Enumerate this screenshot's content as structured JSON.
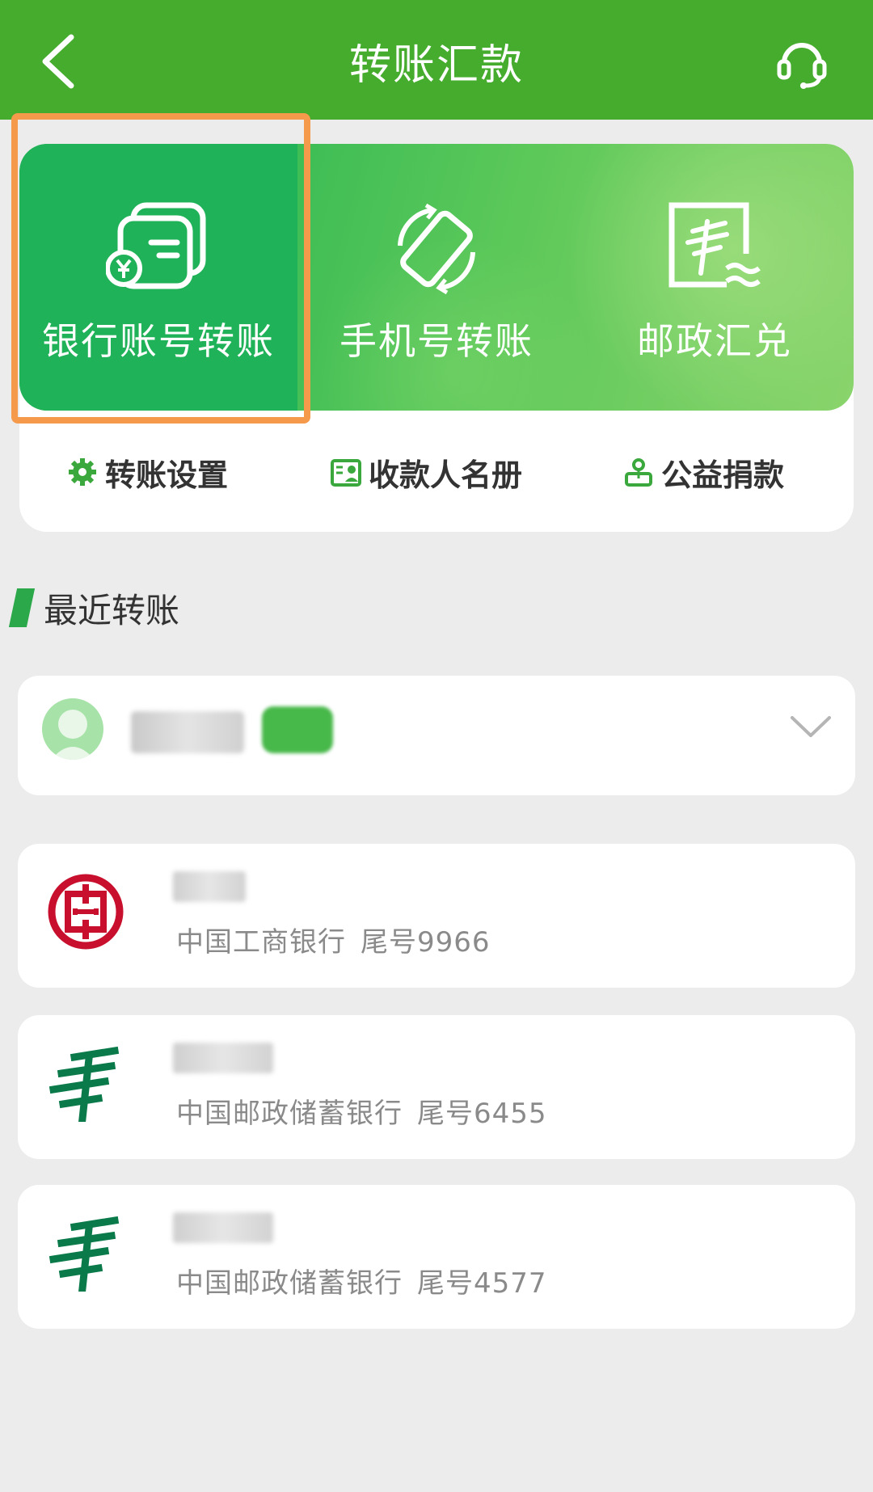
{
  "header": {
    "title": "转账汇款",
    "back_icon": "chevron-left-icon",
    "service_icon": "headset-icon"
  },
  "main_functions": [
    {
      "label": "银行账号转账",
      "icon": "bank-card-transfer-icon",
      "selected": true
    },
    {
      "label": "手机号转账",
      "icon": "phone-rotate-icon",
      "selected": false
    },
    {
      "label": "邮政汇兑",
      "icon": "postal-remittance-icon",
      "selected": false
    }
  ],
  "sub_functions": [
    {
      "label": "转账设置",
      "icon": "gear-icon"
    },
    {
      "label": "收款人名册",
      "icon": "contact-book-icon"
    },
    {
      "label": "公益捐款",
      "icon": "donation-icon"
    }
  ],
  "recent": {
    "title": "最近转账"
  },
  "records": [
    {
      "bank": "中国工商银行",
      "tail": "尾号9966",
      "logo": "icbc-logo-icon"
    },
    {
      "bank": "中国邮政储蓄银行",
      "tail": "尾号6455",
      "logo": "psbc-logo-icon"
    },
    {
      "bank": "中国邮政储蓄银行",
      "tail": "尾号4577",
      "logo": "psbc-logo-icon"
    }
  ],
  "colors": {
    "header_green": "#45ac2d",
    "selected_green": "#1fb259",
    "highlight_orange": "#f59a4a",
    "icbc_red": "#c8102e",
    "psbc_green": "#0a7a4a"
  }
}
